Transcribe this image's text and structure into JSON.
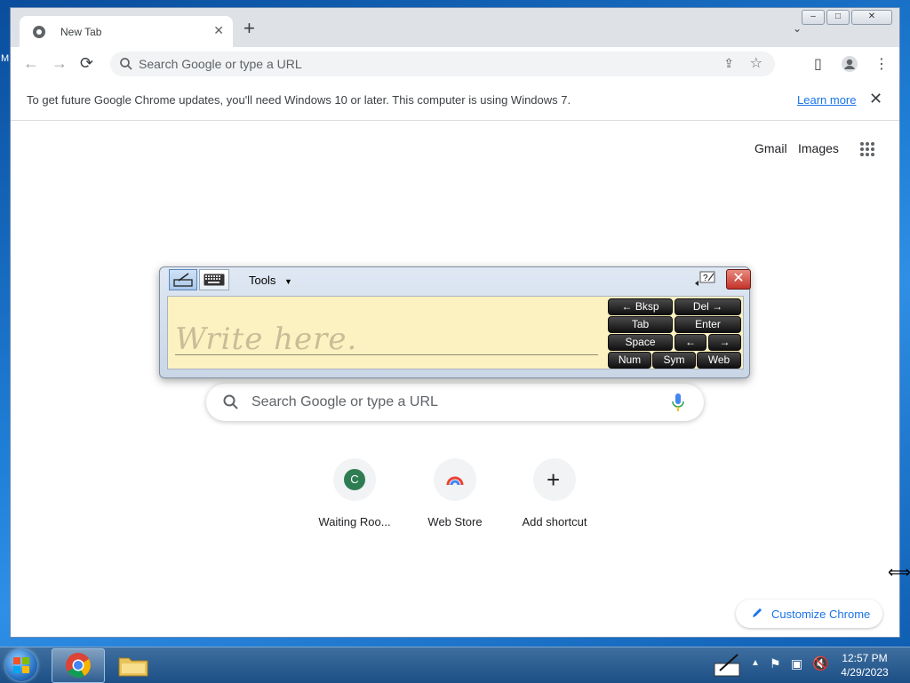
{
  "desktop": {
    "left_text": "M"
  },
  "tab": {
    "title": "New Tab",
    "close": "✕"
  },
  "window_controls": {
    "minimize": "–",
    "maximize": "□",
    "close": "✕"
  },
  "toolbar": {
    "back": "←",
    "forward": "→",
    "reload": "⟳",
    "omnibox_placeholder": "Search Google or type a URL"
  },
  "infobar": {
    "message": "To get future Google Chrome updates, you'll need Windows 10 or later. This computer is using Windows 7.",
    "link": "Learn more",
    "close": "✕"
  },
  "ntp": {
    "gmail": "Gmail",
    "images": "Images",
    "search_placeholder": "Search Google or type a URL",
    "shortcuts": [
      {
        "label": "Waiting Roo...",
        "initial": "C"
      },
      {
        "label": "Web Store"
      },
      {
        "label": "Add shortcut",
        "glyph": "+"
      }
    ],
    "customize": "Customize Chrome"
  },
  "input_panel": {
    "tools": "Tools",
    "write_here": "Write here.",
    "keys": {
      "bksp": "← Bksp",
      "del": "Del →",
      "tab": "Tab",
      "enter": "Enter",
      "space": "Space",
      "left": "←",
      "right": "→",
      "num": "Num",
      "sym": "Sym",
      "web": "Web"
    }
  },
  "taskbar": {
    "time": "12:57 PM",
    "date": "4/29/2023"
  },
  "colors": {
    "accent": "#1a73e8",
    "taskbar": "#1c4f86",
    "pad": "#fcf1c1"
  }
}
